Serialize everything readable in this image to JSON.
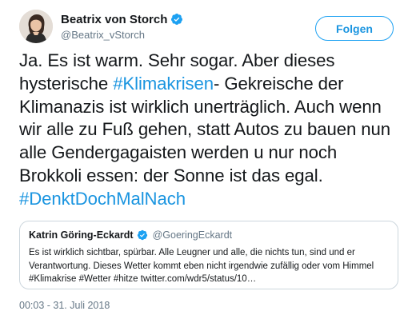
{
  "author": {
    "display_name": "Beatrix von Storch",
    "handle": "@Beatrix_vStorch",
    "verified_icon": "verified-badge-icon"
  },
  "follow_button": {
    "label": "Folgen"
  },
  "tweet": {
    "text_parts": [
      "Ja. Es ist warm. Sehr sogar. Aber dieses hysterische ",
      "#Klimakrisen",
      "- Gekreische der Klimanazis ist wirklich unerträglich. Auch wenn wir alle zu Fuß gehen, statt Autos zu bauen nun alle Gendergagaisten werden u nur noch Brokkoli essen: der Sonne ist das egal. ",
      "#DenktDochMalNach"
    ]
  },
  "quoted_tweet": {
    "display_name": "Katrin Göring-Eckardt",
    "handle": "@GoeringEckardt",
    "text": "Es ist wirklich sichtbar, spürbar. Alle Leugner und alle, die nichts tun, sind und er Verantwortung. Dieses Wetter kommt eben nicht irgendwie zufällig oder vom Himmel #Klimakrise #Wetter #hitze twitter.com/wdr5/status/10…"
  },
  "timestamp": "00:03 - 31. Juli 2018",
  "colors": {
    "link": "#1b95e0",
    "verified": "#1da1f2",
    "secondary_text": "#657786",
    "border": "#ccd6dd"
  }
}
